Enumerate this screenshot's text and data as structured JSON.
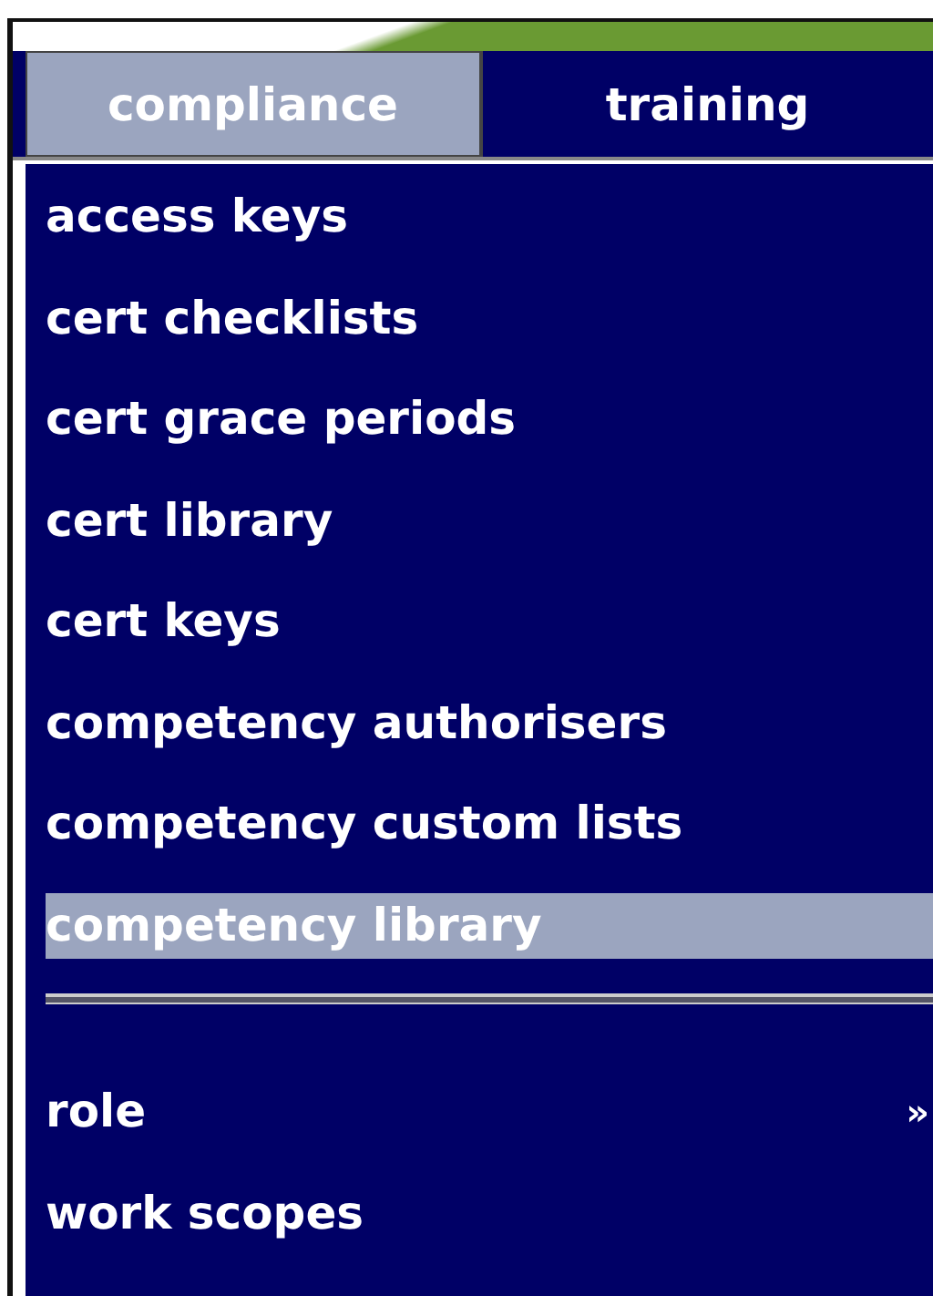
{
  "tabs": [
    {
      "label": "compliance",
      "selected": true
    },
    {
      "label": "training",
      "selected": false
    }
  ],
  "menu": [
    {
      "kind": "item",
      "label": "access keys",
      "selected": false
    },
    {
      "kind": "item",
      "label": "cert checklists",
      "selected": false
    },
    {
      "kind": "item",
      "label": "cert grace periods",
      "selected": false
    },
    {
      "kind": "item",
      "label": "cert library",
      "selected": false
    },
    {
      "kind": "item",
      "label": "cert keys",
      "selected": false
    },
    {
      "kind": "item",
      "label": "competency authorisers",
      "selected": false
    },
    {
      "kind": "item",
      "label": "competency custom lists",
      "selected": false
    },
    {
      "kind": "item",
      "label": "competency library",
      "selected": true
    },
    {
      "kind": "separator"
    },
    {
      "kind": "item",
      "label": "role",
      "selected": false,
      "arrow": "»"
    },
    {
      "kind": "item",
      "label": "work scopes",
      "selected": false
    }
  ]
}
